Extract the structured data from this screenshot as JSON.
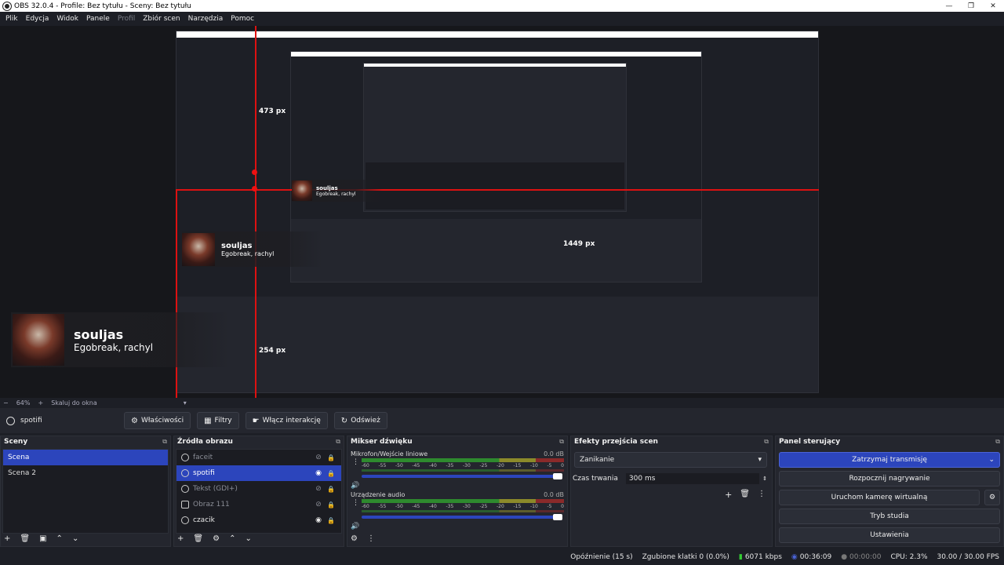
{
  "window": {
    "title": "OBS 32.0.4 - Profile: Bez tytułu - Sceny: Bez tytułu",
    "controls": [
      "—",
      "❐",
      "✕"
    ]
  },
  "menu": [
    "Plik",
    "Edycja",
    "Widok",
    "Panele",
    "Profil",
    "Zbiór scen",
    "Narzędzia",
    "Pomoc"
  ],
  "menu_disabled": "Profil",
  "preview": {
    "measure_top": "473 px",
    "measure_right": "1449 px",
    "measure_bottom": "254 px",
    "overlay_title": "souljas",
    "overlay_subtitle": "Egobreak, rachyl"
  },
  "scale_bar": {
    "minus": "−",
    "zoom": "64%",
    "plus": "+",
    "mode": "Skaluj do okna"
  },
  "source_toolbar": {
    "source_name": "spotifi",
    "properties": "Właściwości",
    "filters": "Filtry",
    "interact": "Włącz interakcję",
    "refresh": "Odśwież"
  },
  "scenes": {
    "title": "Sceny",
    "items": [
      "Scena",
      "Scena 2"
    ],
    "selected": 0
  },
  "sources": {
    "title": "Źródła obrazu",
    "items": [
      {
        "name": "faceit",
        "visible": false,
        "locked": true
      },
      {
        "name": "spotifi",
        "visible": true,
        "locked": true,
        "selected": true
      },
      {
        "name": "Tekst (GDI+)",
        "visible": false,
        "locked": true
      },
      {
        "name": "Obraz 111",
        "visible": false,
        "locked": true
      },
      {
        "name": "czacik",
        "visible": true,
        "locked": true
      }
    ]
  },
  "mixer": {
    "title": "Mikser dźwięku",
    "channels": [
      {
        "name": "Mikrofon/Wejście liniowe",
        "db": "0.0 dB"
      },
      {
        "name": "Urządzenie audio",
        "db": "0.0 dB"
      }
    ],
    "scale": [
      "-60",
      "-55",
      "-50",
      "-45",
      "-40",
      "-35",
      "-30",
      "-25",
      "-20",
      "-15",
      "-10",
      "-5",
      "0"
    ]
  },
  "transitions": {
    "title": "Efekty przejścia scen",
    "selected": "Zanikanie",
    "duration_label": "Czas trwania",
    "duration_value": "300 ms"
  },
  "controls": {
    "title": "Panel sterujący",
    "stream": "Zatrzymaj transmisję",
    "record": "Rozpocznij nagrywanie",
    "virtualcam": "Uruchom kamerę wirtualną",
    "studio": "Tryb studia",
    "settings": "Ustawienia"
  },
  "status": {
    "delay": "Opóźnienie (15 s)",
    "dropped": "Zgubione klatki 0 (0.0%)",
    "bitrate": "6071 kbps",
    "stream_time": "00:36:09",
    "rec_time": "00:00:00",
    "cpu": "CPU: 2.3%",
    "fps": "30.00 / 30.00 FPS"
  },
  "colors": {
    "accent": "#2c45bc",
    "guide": "#dd1111",
    "bg": "#1d1f26"
  }
}
